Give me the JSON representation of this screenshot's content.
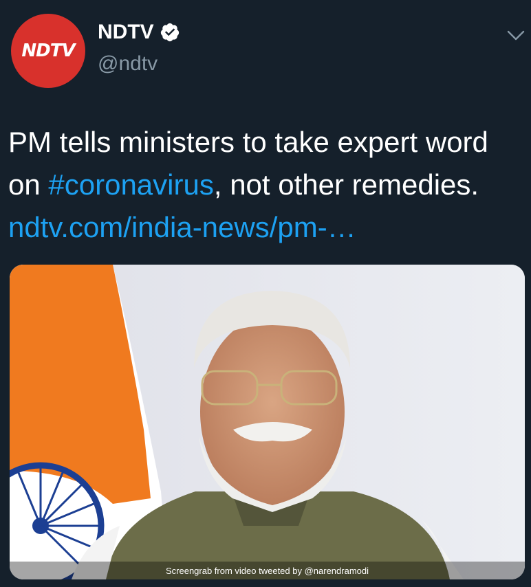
{
  "account": {
    "avatar_text": "NDTV",
    "display_name": "NDTV",
    "handle": "@ndtv",
    "verified": true
  },
  "tweet": {
    "text_part1": "PM tells ministers to take expert word on ",
    "hashtag": "#coronavirus",
    "text_part2": ", not other remedies.",
    "link": "ndtv.com/india-news/pm-…"
  },
  "media": {
    "caption": "Screengrab from video tweeted by @narendramodi"
  },
  "colors": {
    "background": "#15202b",
    "link": "#1da1f2",
    "secondary_text": "#8899a6",
    "brand_red": "#d8312c"
  },
  "icons": [
    "verified-badge-icon",
    "chevron-down-icon"
  ]
}
